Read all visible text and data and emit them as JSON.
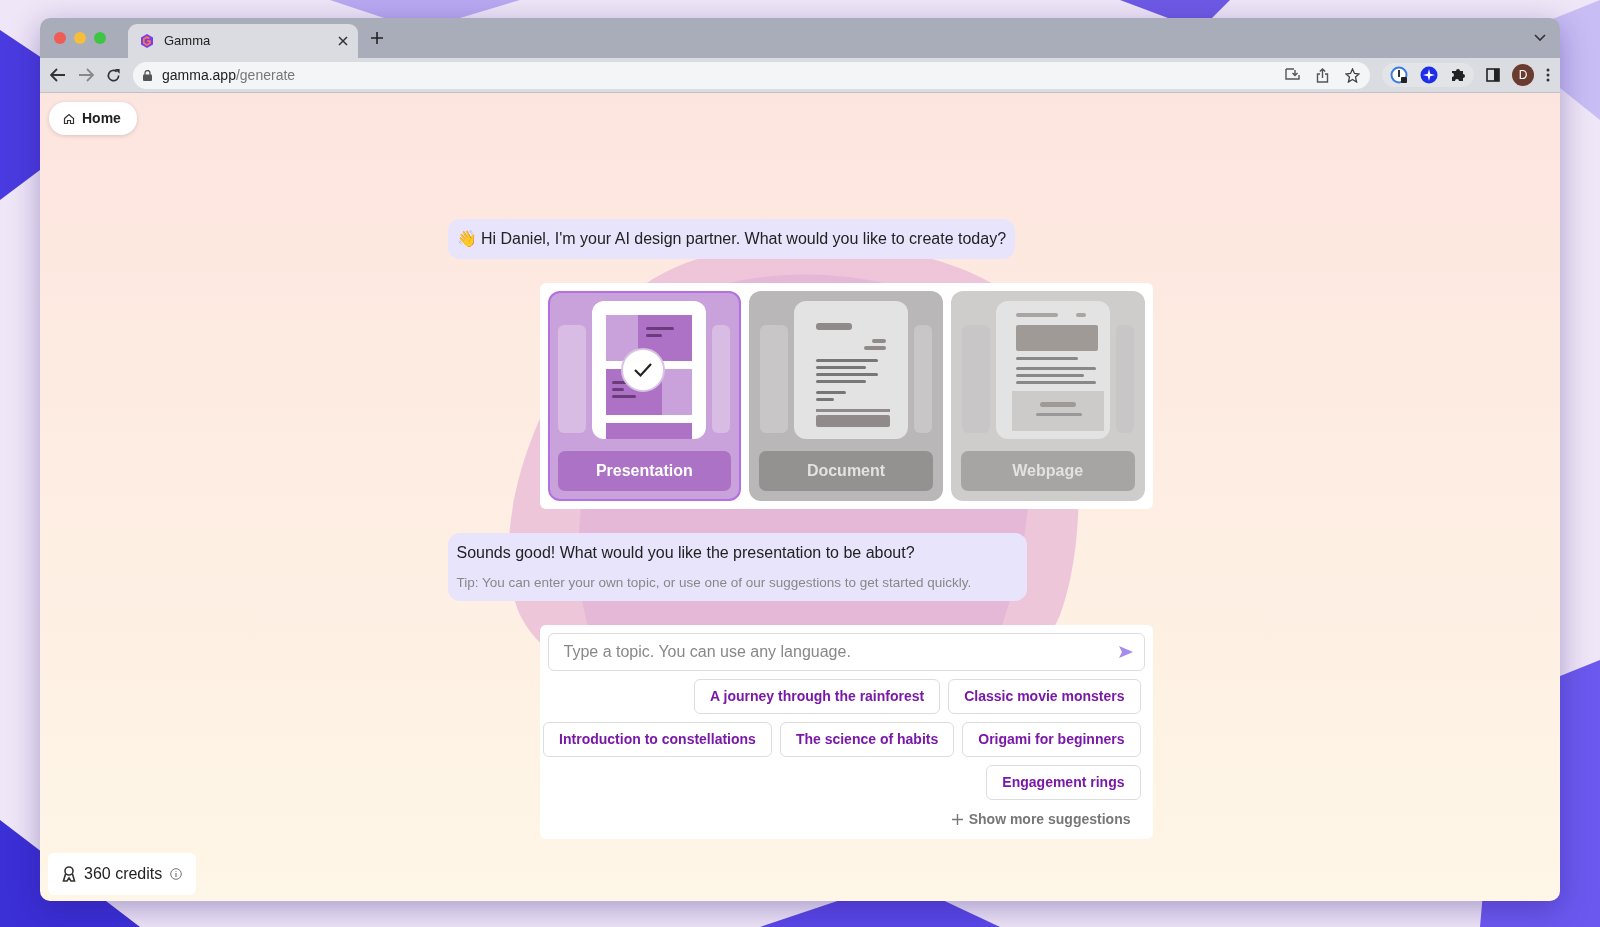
{
  "browser": {
    "tab": {
      "title": "Gamma"
    },
    "address": {
      "host": "gamma.app",
      "path": "/generate"
    },
    "profile_initial": "D"
  },
  "home_button": {
    "label": "Home"
  },
  "greeting": {
    "emoji": "👋",
    "text": "Hi Daniel, I'm your AI design partner. What would you like to create today?"
  },
  "formats": [
    {
      "kind": "presentation",
      "label": "Presentation",
      "selected": true
    },
    {
      "kind": "document",
      "label": "Document",
      "selected": false
    },
    {
      "kind": "webpage",
      "label": "Webpage",
      "selected": false
    }
  ],
  "prompt": {
    "question": "Sounds good! What would you like the presentation to be about?",
    "tip": "Tip: You can enter your own topic, or use one of our suggestions to get started quickly."
  },
  "topic_input": {
    "placeholder": "Type a topic. You can use any language."
  },
  "suggestions": [
    [
      "A journey through the rainforest",
      "Classic movie monsters"
    ],
    [
      "Introduction to constellations",
      "The science of habits",
      "Origami for beginners"
    ],
    [
      "Engagement rings"
    ]
  ],
  "show_more": {
    "label": "Show more suggestions"
  },
  "credits": {
    "label": "360 credits"
  }
}
